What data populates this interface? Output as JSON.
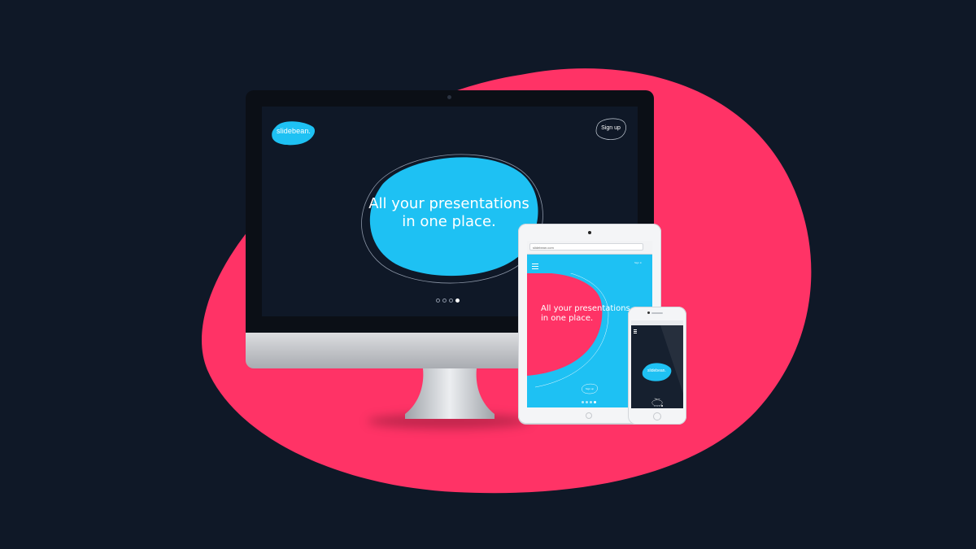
{
  "colors": {
    "background": "#0f1827",
    "accent_pink": "#ff3366",
    "accent_blue": "#1ec1f3"
  },
  "desktop": {
    "logo_text": "slidebean.",
    "signup_label": "Sign up",
    "hero_line1": "All your presentations",
    "hero_line2": "in one place.",
    "slide_count": 4,
    "active_slide": 4
  },
  "tablet": {
    "url": "slidebean.com",
    "signin_label": "Sign in",
    "hero_line1": "All your presentations",
    "hero_line2": "in one place.",
    "signup_label": "Sign up"
  },
  "phone": {
    "logo_text": "slidebean.",
    "signup_label": "Sign up"
  }
}
